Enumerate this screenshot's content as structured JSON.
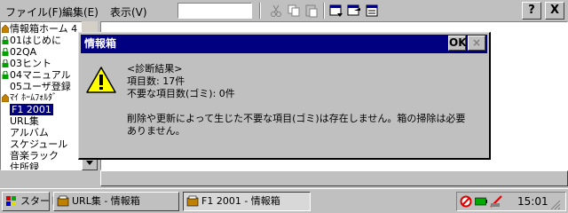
{
  "menu": {
    "file": "ファイル(F)",
    "edit": "編集(E)",
    "view": "表示(V)"
  },
  "toolbar": {
    "icons": [
      "cut-icon",
      "copy-icon",
      "paste-icon",
      "window-icon",
      "window-arrow-icon",
      "window-list-icon",
      "help-icon",
      "close-icon"
    ],
    "help_label": "?",
    "close_label": "X"
  },
  "tree": {
    "items": [
      {
        "label": "情報箱ホーム 4",
        "icon": "home-icon"
      },
      {
        "label": "01はじめに",
        "icon": "lock-icon"
      },
      {
        "label": "02QA",
        "icon": "lock-icon"
      },
      {
        "label": "03ヒント",
        "icon": "lock-icon"
      },
      {
        "label": "04マニュアル",
        "icon": "lock-icon"
      },
      {
        "label": "05ユーザ登録",
        "icon": "none"
      },
      {
        "label": "ﾏｲ ﾎｰﾑﾌｫﾙﾀﾞ",
        "icon": "home-icon"
      },
      {
        "label": "F1 2001",
        "icon": "none",
        "selected": true
      },
      {
        "label": "URL集",
        "icon": "none"
      },
      {
        "label": "アルバム",
        "icon": "none"
      },
      {
        "label": "スケジュール",
        "icon": "none"
      },
      {
        "label": "音楽ラック",
        "icon": "none"
      },
      {
        "label": "住所録",
        "icon": "none"
      }
    ]
  },
  "dialog": {
    "title": "情報箱",
    "ok_label": "OK",
    "close_label": "×",
    "icon": "warning-icon",
    "lines": [
      "<診断結果>",
      "項目数: 17件",
      "不要な項目数(ゴミ): 0件",
      "",
      "削除や更新によって生じた不要な項目(ゴミ)は存在しません。箱の掃除は必要",
      "ありません。"
    ]
  },
  "taskbar": {
    "start_label": "スタート",
    "tasks": [
      {
        "label": "URL集 - 情報箱",
        "icon": "infobox-icon",
        "active": false
      },
      {
        "label": "F1 2001 - 情報箱",
        "icon": "infobox-icon",
        "active": true
      }
    ],
    "tray_icons": [
      "no-entry-icon",
      "battery-icon",
      "pen-icon"
    ],
    "clock": "15:01"
  }
}
